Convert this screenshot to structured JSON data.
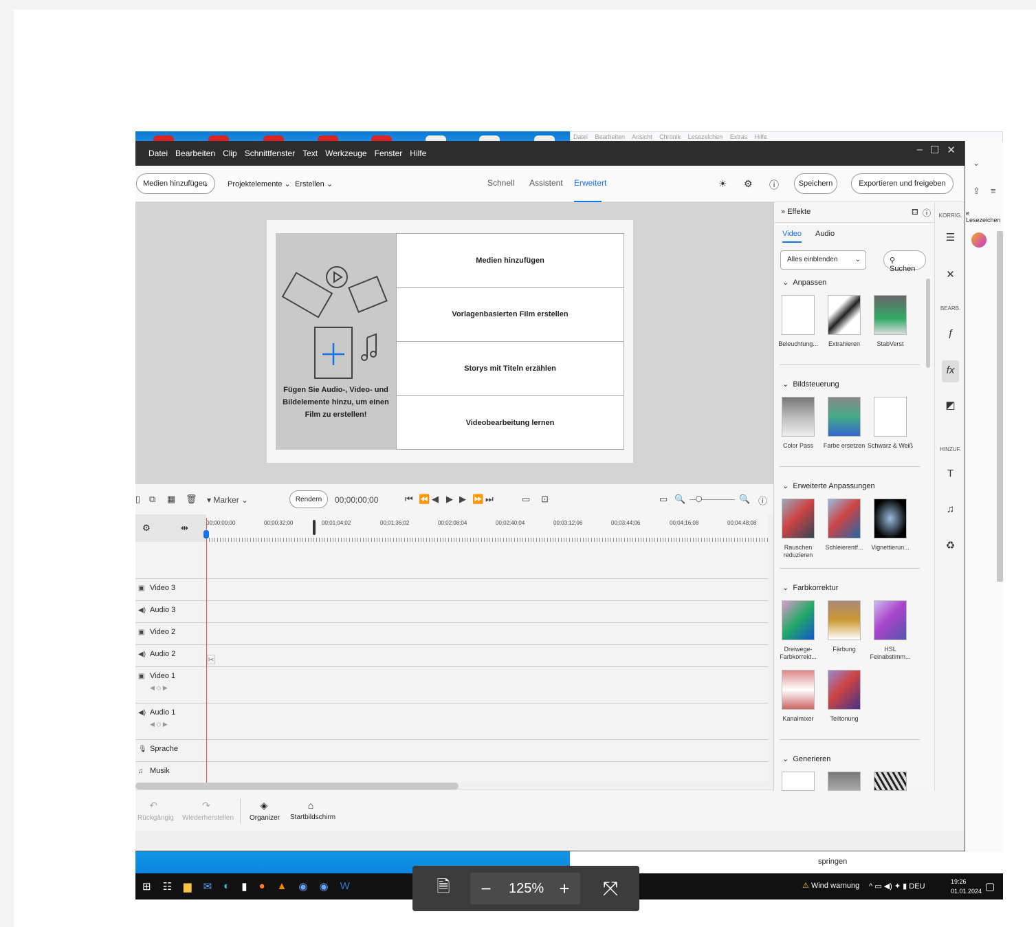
{
  "browser": {
    "menu": [
      "Datei",
      "Bearbeiten",
      "Ansicht",
      "Chronik",
      "Lesezeichen",
      "Extras",
      "Hilfe"
    ],
    "bookmarks_label": "e Lesezeichen",
    "page_text": "springen"
  },
  "app": {
    "menu": [
      "Datei",
      "Bearbeiten",
      "Clip",
      "Schnittfenster",
      "Text",
      "Werkzeuge",
      "Fenster",
      "Hilfe"
    ],
    "toolbar": {
      "add_media": "Medien hinzufügen",
      "project_assets": "Projektelemente",
      "create": "Erstellen",
      "save": "Speichern",
      "export": "Exportieren und freigeben"
    },
    "modes": [
      "Schnell",
      "Assistent",
      "Erweitert"
    ],
    "active_mode": "Erweitert",
    "welcome": {
      "hint": "Fügen Sie Audio-, Video- und Bildelemente hinzu, um einen Film zu erstellen!",
      "options": [
        "Medien hinzufügen",
        "Vorlagenbasierten Film erstellen",
        "Storys mit Titeln erzählen",
        "Videobearbeitung lernen"
      ]
    },
    "timeline": {
      "marker": "Marker",
      "render": "Rendern",
      "timecode": "00;00;00;00",
      "ticks": [
        "00;00;00;00",
        "00;00;32;00",
        "00;01;04;02",
        "00;01;36;02",
        "00;02;08;04",
        "00;02;40;04",
        "00;03;12;06",
        "00;03;44;06",
        "00;04;16;08",
        "00;04;48;08"
      ],
      "tracks": [
        "Video 3",
        "Audio 3",
        "Video 2",
        "Audio 2",
        "Video 1",
        "Audio 1",
        "Sprache",
        "Musik"
      ]
    },
    "bottom": {
      "undo": "Rückgängig",
      "redo": "Wiederherstellen",
      "organizer": "Organizer",
      "home": "Startbildschirm"
    },
    "effects": {
      "title": "Effekte",
      "tabs": [
        "Video",
        "Audio"
      ],
      "filter": "Alles einblenden",
      "search": "Suchen",
      "sections": [
        {
          "name": "Anpassen",
          "items": [
            "Beleuchtung...",
            "Extrahieren",
            "StabVerst"
          ]
        },
        {
          "name": "Bildsteuerung",
          "items": [
            "Color Pass",
            "Farbe ersetzen",
            "Schwarz & Weiß"
          ]
        },
        {
          "name": "Erweiterte Anpassungen",
          "items": [
            "Rauschen reduzieren",
            "Schleierentf...",
            "Vignettierun..."
          ]
        },
        {
          "name": "Farbkorrektur",
          "items": [
            "Dreiwege-Farbkorrekt...",
            "Färbung",
            "HSL Feinabstimm...",
            "Kanalmixer",
            "Teiltonung"
          ]
        },
        {
          "name": "Generieren",
          "items": []
        }
      ]
    },
    "rail": {
      "korrig": "KORRIG.",
      "bearb": "BEARB.",
      "hinzuf": "HINZUF."
    }
  },
  "taskbar": {
    "weather": "Wind warnung",
    "lang": "DEU",
    "time": "19:26",
    "date": "01.01.2024"
  },
  "zoom": {
    "value": "125%"
  }
}
